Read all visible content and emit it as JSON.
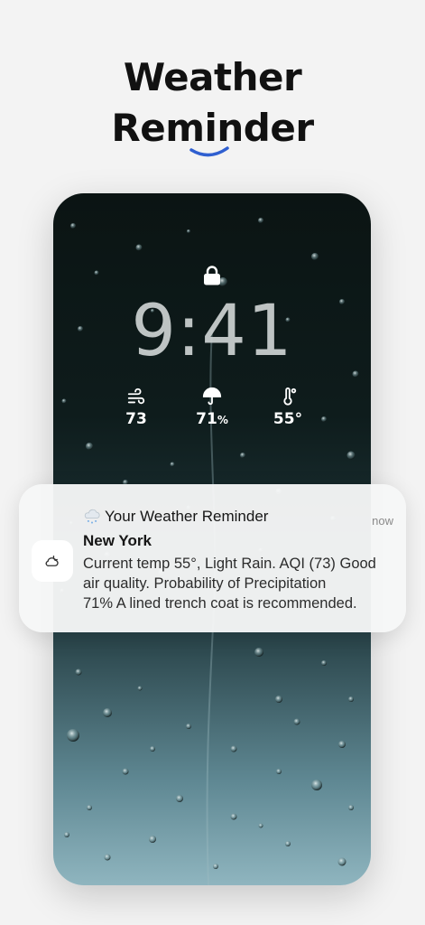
{
  "promo": {
    "title_line1": "Weather",
    "title_line2": "Reminder"
  },
  "lock_screen": {
    "time": "9:41",
    "widgets": [
      {
        "icon": "wind-icon",
        "value": "73",
        "unit": ""
      },
      {
        "icon": "umbrella-icon",
        "value": "71",
        "unit": "%"
      },
      {
        "icon": "thermometer-icon",
        "value": "55°",
        "unit": ""
      }
    ]
  },
  "notification": {
    "app_icon": "cloud-moon-icon",
    "header_icon": "cloud-snow-emoji",
    "title": "Your Weather Reminder",
    "time": "now",
    "city": "New York",
    "body": "Current temp 55°, Light Rain. AQI (73) Good\nair quality. Probability of Precipitation\n 71% A lined trench coat is recommended."
  },
  "colors": {
    "accent": "#2f5fd0",
    "background": "#f3f3f3"
  }
}
